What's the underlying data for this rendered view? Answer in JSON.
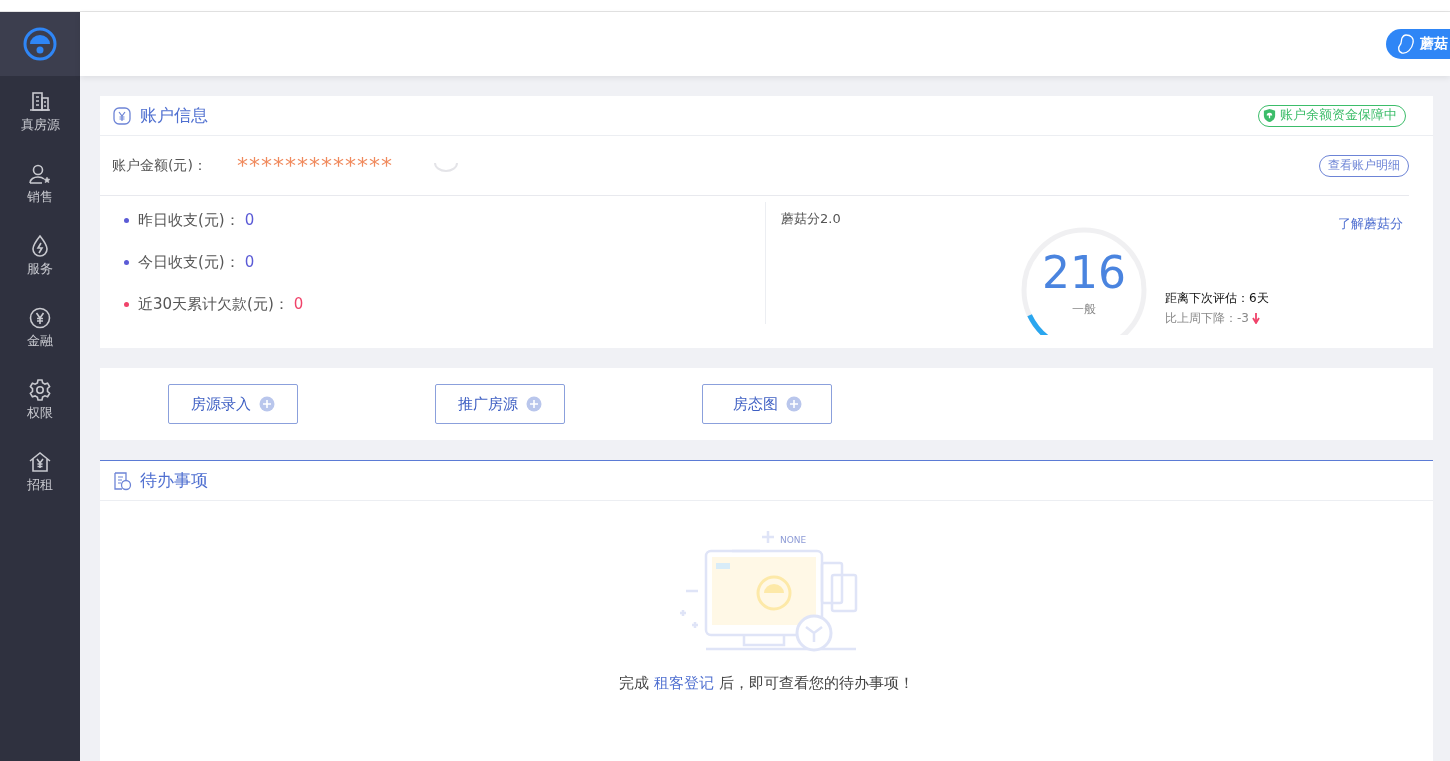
{
  "sidebar": {
    "items": [
      {
        "label": "真房源"
      },
      {
        "label": "销售"
      },
      {
        "label": "服务"
      },
      {
        "label": "金融"
      },
      {
        "label": "权限"
      },
      {
        "label": "招租"
      }
    ]
  },
  "header": {
    "button": "蘑菇"
  },
  "account": {
    "title": "账户信息",
    "guarantee_badge": "账户余额资金保障中",
    "balance_label": "账户金额(元)：",
    "balance_value": "*************",
    "detail_button": "查看账户明细",
    "stats": [
      {
        "label": "昨日收支(元)：",
        "value": "0",
        "color": "#5b5bd6"
      },
      {
        "label": "今日收支(元)：",
        "value": "0",
        "color": "#5b5bd6"
      },
      {
        "label": "近30天累计欠款(元)：",
        "value": "0",
        "color": "#f0436a"
      }
    ],
    "score": {
      "title": "蘑菇分2.0",
      "link": "了解蘑菇分",
      "value": "216",
      "grade": "一般",
      "level": 0.09,
      "next_eval": "距离下次评估：6天",
      "change": "比上周下降：-3"
    }
  },
  "actions": [
    {
      "label": "房源录入"
    },
    {
      "label": "推广房源"
    },
    {
      "label": "房态图"
    }
  ],
  "todo": {
    "title": "待办事项",
    "illustration_caption": "NONE",
    "message_before": "完成",
    "message_link": "租客登记",
    "message_after": "后，即可查看您的待办事项！"
  }
}
